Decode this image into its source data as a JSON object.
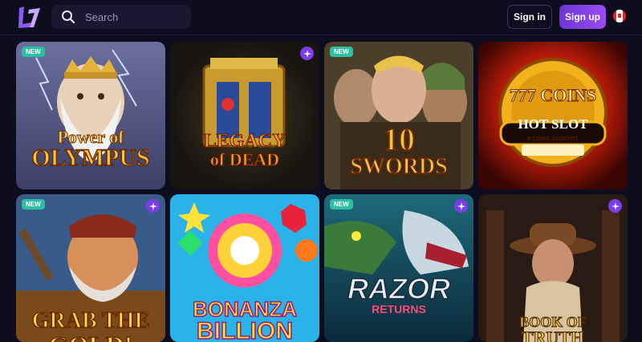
{
  "header": {
    "search_placeholder": "Search",
    "signin_label": "Sign in",
    "signup_label": "Sign up"
  },
  "colors": {
    "background": "#0e0c1f",
    "search_bg": "#1a1830",
    "signup_accent": "#7c3fe4",
    "badge_new": "#2bbfa3",
    "badge_star": "#7a3ee6"
  },
  "games": [
    {
      "title_line1": "Power of",
      "title_line2": "OLYMPUS",
      "badge": "NEW",
      "badge_icon": ""
    },
    {
      "title_line1": "LEGACY",
      "title_line2": "of DEAD",
      "badge": "",
      "badge_icon": "star-badge-icon"
    },
    {
      "title_line1": "10",
      "title_line2": "SWORDS",
      "badge": "NEW",
      "badge_icon": ""
    },
    {
      "title_line1": "777 COINS",
      "title_line2": "HOT SLOT",
      "subtitle": "9 COINS JACKPOT",
      "badge": "",
      "badge_icon": ""
    },
    {
      "title_line1": "GRAB THE",
      "title_line2": "GOLD!",
      "badge": "NEW",
      "badge_icon": "star-badge-icon"
    },
    {
      "title_line1": "BONANZA",
      "title_line2": "BILLION",
      "badge": "",
      "badge_icon": ""
    },
    {
      "title_line1": "RAZOR",
      "title_line2": "RETURNS",
      "badge": "NEW",
      "badge_icon": "star-badge-icon"
    },
    {
      "title_line1": "BOOK OF",
      "title_line2": "TRUTH",
      "badge": "",
      "badge_icon": "star-badge-icon"
    }
  ]
}
